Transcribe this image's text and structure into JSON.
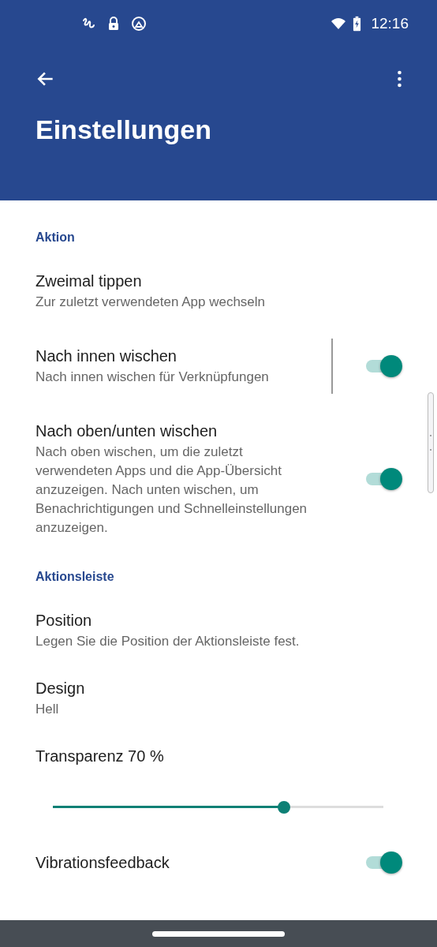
{
  "status_bar": {
    "time": "12:16"
  },
  "app_bar": {
    "title": "Einstellungen"
  },
  "sections": [
    {
      "header": "Aktion",
      "items": [
        {
          "kind": "text",
          "title": "Zweimal tippen",
          "subtitle": "Zur zuletzt verwendeten App wechseln"
        },
        {
          "kind": "split_switch",
          "title": "Nach innen wischen",
          "subtitle": "Nach innen wischen für Verknüpfungen",
          "on": true
        },
        {
          "kind": "switch",
          "title": "Nach oben/unten wischen",
          "subtitle": "Nach oben wischen, um die zuletzt verwendeten Apps und die App-Übersicht anzuzeigen. Nach unten wischen, um Benachrichtigungen und Schnelleinstellungen anzuzeigen.",
          "on": true
        }
      ]
    },
    {
      "header": "Aktionsleiste",
      "items": [
        {
          "kind": "text",
          "title": "Position",
          "subtitle": "Legen Sie die Position der Aktionsleiste fest."
        },
        {
          "kind": "text",
          "title": "Design",
          "subtitle": "Hell"
        },
        {
          "kind": "slider",
          "title": "Transparenz 70 %",
          "level": 0.7
        },
        {
          "kind": "switch",
          "title": "Vibrationsfeedback",
          "on": true
        }
      ]
    }
  ]
}
